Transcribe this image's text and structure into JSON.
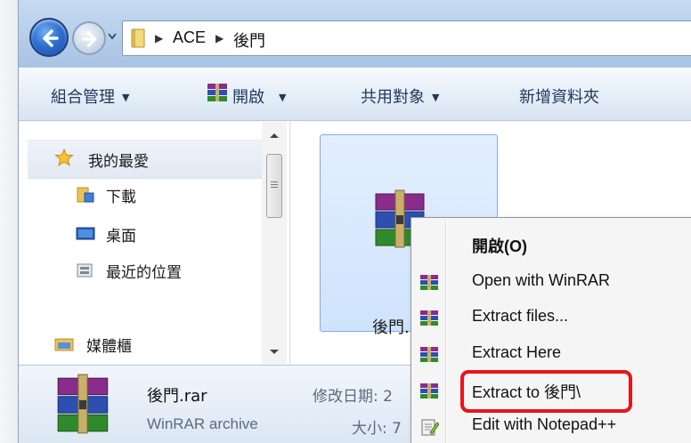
{
  "address": {
    "segments": [
      "ACE",
      "後門"
    ]
  },
  "toolbar": {
    "organize": "組合管理",
    "open": "開啟",
    "share": "共用對象",
    "new_folder": "新增資料夾"
  },
  "nav": {
    "favorites": "我的最愛",
    "downloads": "下載",
    "desktop": "桌面",
    "recent": "最近的位置",
    "libraries": "媒體櫃"
  },
  "file": {
    "label": "後門."
  },
  "details": {
    "name": "後門.rar",
    "type": "WinRAR archive",
    "modified_label": "修改日期: 2",
    "size_label": "大小: 7"
  },
  "context_menu": {
    "items": [
      {
        "label": "開啟(O)",
        "bold": true,
        "icon": "none"
      },
      {
        "label": "Open with WinRAR",
        "icon": "winrar-icon"
      },
      {
        "label": "Extract files...",
        "icon": "winrar-icon"
      },
      {
        "label": "Extract Here",
        "icon": "winrar-icon"
      },
      {
        "label": "Extract to 後門\\",
        "icon": "winrar-icon",
        "highlighted": true
      },
      {
        "label": "Edit with Notepad++",
        "icon": "notepadpp-icon"
      }
    ]
  },
  "colors": {
    "highlight": "#e8141b",
    "selection": "#cfe3fd"
  }
}
